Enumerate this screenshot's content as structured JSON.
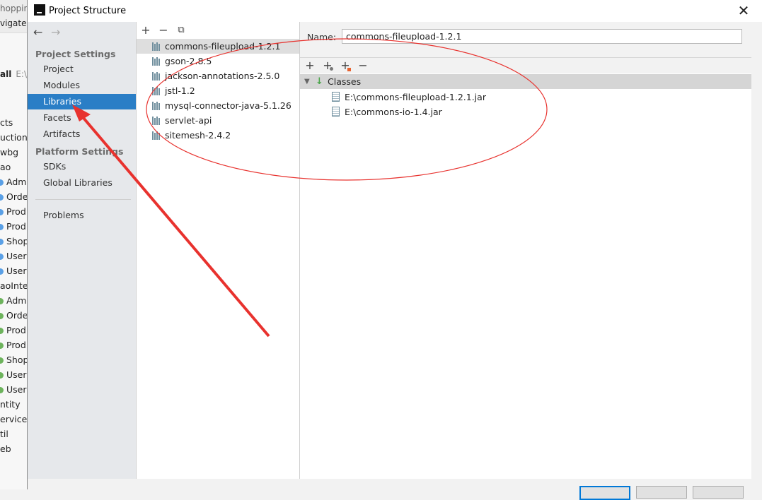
{
  "background_ide": {
    "tab_text": "hoppin",
    "menu_text": "vigate",
    "project_header_bold": "all",
    "project_header_path": "E:\\",
    "tree_rows": [
      {
        "text": "cts",
        "dot": ""
      },
      {
        "text": "uction",
        "dot": ""
      },
      {
        "text": "wbg",
        "dot": ""
      },
      {
        "text": "ao",
        "dot": ""
      },
      {
        "text": "Admi",
        "dot": "blue"
      },
      {
        "text": "Orde",
        "dot": "blue"
      },
      {
        "text": "Prod",
        "dot": "blue"
      },
      {
        "text": "Prod",
        "dot": "blue"
      },
      {
        "text": "Shop",
        "dot": "blue"
      },
      {
        "text": "User",
        "dot": "blue"
      },
      {
        "text": "User",
        "dot": "blue"
      },
      {
        "text": "aoInter",
        "dot": ""
      },
      {
        "text": "Admi",
        "dot": "green"
      },
      {
        "text": "Orde",
        "dot": "green"
      },
      {
        "text": "Prod",
        "dot": "green"
      },
      {
        "text": "Prod",
        "dot": "green"
      },
      {
        "text": "Shop",
        "dot": "green"
      },
      {
        "text": "User",
        "dot": "green"
      },
      {
        "text": "User",
        "dot": "green"
      },
      {
        "text": "ntity",
        "dot": ""
      },
      {
        "text": "ervice",
        "dot": ""
      },
      {
        "text": "til",
        "dot": ""
      },
      {
        "text": "eb",
        "dot": ""
      }
    ]
  },
  "dialog": {
    "title": "Project Structure",
    "close_glyph": "✕"
  },
  "nav": {
    "back_glyph": "←",
    "forward_glyph": "→",
    "project_settings_heading": "Project Settings",
    "project_settings_items": [
      "Project",
      "Modules",
      "Libraries",
      "Facets",
      "Artifacts"
    ],
    "platform_settings_heading": "Platform Settings",
    "platform_settings_items": [
      "SDKs",
      "Global Libraries"
    ],
    "other_items": [
      "Problems"
    ],
    "selected": "Libraries"
  },
  "libraries": {
    "toolbar": {
      "add": "+",
      "remove": "−",
      "copy": "⧉"
    },
    "items": [
      "commons-fileupload-1.2.1",
      "gson-2.8.5",
      "jackson-annotations-2.5.0",
      "jstl-1.2",
      "mysql-connector-java-5.1.26",
      "servlet-api",
      "sitemesh-2.4.2"
    ],
    "selected": "commons-fileupload-1.2.1"
  },
  "detail": {
    "name_label": "Name:",
    "name_value": "commons-fileupload-1.2.1",
    "toolbar": {
      "add": "+",
      "add_with_settings": "+",
      "add_special": "+",
      "remove": "−"
    },
    "classes_label": "Classes",
    "classes_expanded": true,
    "jar_files": [
      "E:\\commons-fileupload-1.2.1.jar",
      "E:\\commons-io-1.4.jar"
    ]
  },
  "annotation": {
    "color": "#e8322e"
  }
}
